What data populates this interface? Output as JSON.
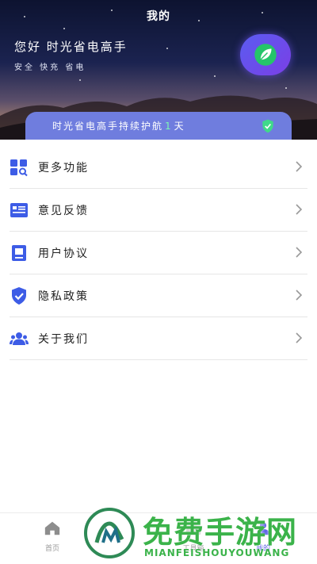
{
  "header": {
    "title": "我的",
    "greeting": "您好 时光省电高手",
    "tagline": "安全 快充 省电"
  },
  "guard": {
    "text_before": "时光省电高手持续护航",
    "days": "1",
    "text_after": "天"
  },
  "menu": {
    "items": [
      {
        "label": "更多功能",
        "icon": "grid-search-icon"
      },
      {
        "label": "意见反馈",
        "icon": "feedback-icon"
      },
      {
        "label": "用户协议",
        "icon": "document-icon"
      },
      {
        "label": "隐私政策",
        "icon": "shield-check-icon"
      },
      {
        "label": "关于我们",
        "icon": "users-icon"
      }
    ]
  },
  "tabbar": {
    "tabs": [
      {
        "label": "首页",
        "icon": "home-icon",
        "active": false
      },
      {
        "label": "工具箱",
        "icon": "toolbox-icon",
        "active": false
      },
      {
        "label": "我的",
        "icon": "profile-icon",
        "active": true
      }
    ]
  },
  "watermark": {
    "title": "免费手游网",
    "subtitle": "MIANFEISHOUYOUWANG"
  },
  "colors": {
    "accent": "#5b5fe6",
    "guard_bar": "#6f7dde",
    "days_highlight": "#7ef7b3",
    "icon_blue": "#3d5ce6",
    "watermark_green": "#3bb34a"
  }
}
